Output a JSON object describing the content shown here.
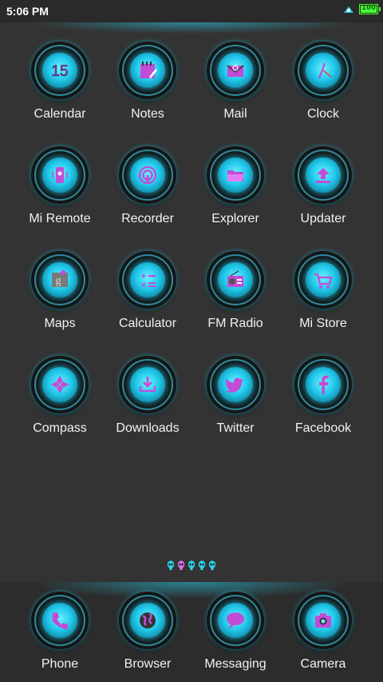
{
  "status": {
    "time": "5:06 PM",
    "battery": "100"
  },
  "apps": [
    {
      "label": "Calendar",
      "icon": "calendar-icon",
      "glyph": "15"
    },
    {
      "label": "Notes",
      "icon": "notes-icon"
    },
    {
      "label": "Mail",
      "icon": "mail-icon"
    },
    {
      "label": "Clock",
      "icon": "clock-icon"
    },
    {
      "label": "Mi Remote",
      "icon": "remote-icon"
    },
    {
      "label": "Recorder",
      "icon": "recorder-icon"
    },
    {
      "label": "Explorer",
      "icon": "folder-icon"
    },
    {
      "label": "Updater",
      "icon": "updater-icon"
    },
    {
      "label": "Maps",
      "icon": "maps-icon"
    },
    {
      "label": "Calculator",
      "icon": "calculator-icon"
    },
    {
      "label": "FM Radio",
      "icon": "radio-icon"
    },
    {
      "label": "Mi Store",
      "icon": "cart-icon"
    },
    {
      "label": "Compass",
      "icon": "compass-icon"
    },
    {
      "label": "Downloads",
      "icon": "download-icon"
    },
    {
      "label": "Twitter",
      "icon": "twitter-icon"
    },
    {
      "label": "Facebook",
      "icon": "facebook-icon"
    }
  ],
  "pager": {
    "count": 5,
    "active_index": 1
  },
  "dock": [
    {
      "label": "Phone",
      "icon": "phone-icon"
    },
    {
      "label": "Browser",
      "icon": "globe-icon"
    },
    {
      "label": "Messaging",
      "icon": "message-icon"
    },
    {
      "label": "Camera",
      "icon": "camera-icon"
    }
  ],
  "colors": {
    "accent": "#28c8e6",
    "glyph": "#c24bd8",
    "background": "#333333"
  }
}
